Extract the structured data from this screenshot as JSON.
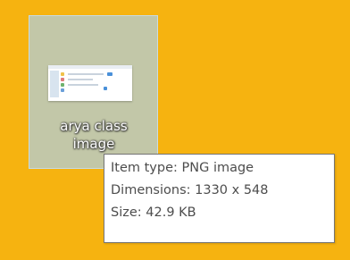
{
  "desktop": {
    "background_color": "#f6b310"
  },
  "file_icon": {
    "icon": "png-image-thumbnail-icon",
    "label_line1": "arya class",
    "label_line2": "image",
    "selected": true
  },
  "tooltip": {
    "item_type": "Item type: PNG image",
    "dimensions": "Dimensions: 1330 x 548",
    "size": "Size: 42.9 KB"
  }
}
